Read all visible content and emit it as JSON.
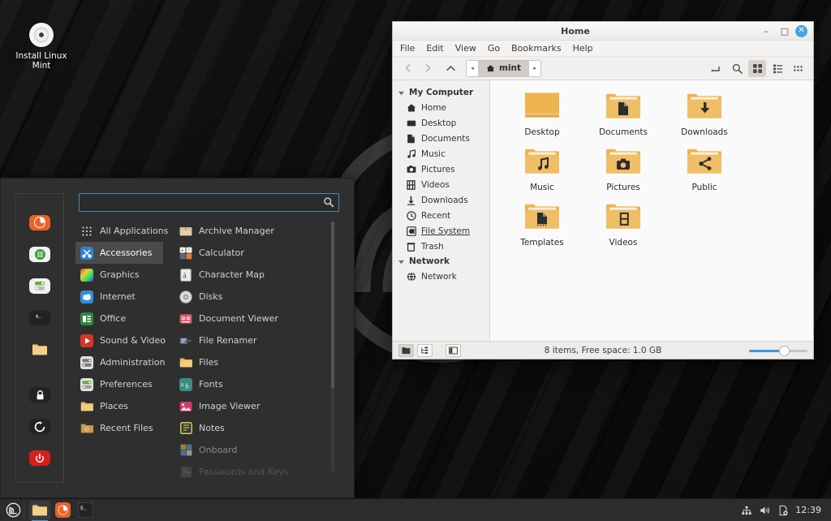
{
  "desktop": {
    "icon": {
      "label": "Install Linux Mint",
      "name": "install-linux-mint-icon"
    }
  },
  "menu": {
    "search": {
      "value": "",
      "placeholder": "",
      "icon": "search-icon"
    },
    "sidebar_icons": [
      {
        "name": "firefox-icon",
        "glyph": "◔",
        "bg": "#ea6227",
        "fg": "#ffffff"
      },
      {
        "name": "software-manager-icon",
        "glyph": "☷",
        "bg": "#f2f2f2",
        "fg": "#3aa143"
      },
      {
        "name": "update-manager-icon",
        "glyph": "☲",
        "bg": "#f2f2f2",
        "fg": "#6aab3d"
      },
      {
        "name": "terminal-icon",
        "glyph": "❯_",
        "bg": "#232323",
        "fg": "#e8e8e8"
      },
      {
        "name": "files-icon",
        "glyph": "▮",
        "bg": "#f0c070",
        "fg": "#f0c070"
      },
      {
        "name": "lock-screen-icon",
        "glyph": "ὑ2",
        "bg": "#232323",
        "fg": "#ffffff"
      },
      {
        "name": "logout-icon",
        "glyph": "↺",
        "bg": "#232323",
        "fg": "#ffffff"
      },
      {
        "name": "quit-icon",
        "glyph": "⏻",
        "bg": "#d81f1f",
        "fg": "#ffffff"
      }
    ],
    "categories": [
      {
        "label": "All Applications",
        "icon": "grid-icon",
        "selected": false,
        "color": "#cfcfcf"
      },
      {
        "label": "Accessories",
        "icon": "accessories-icon",
        "selected": true,
        "color": "#2f7fd0"
      },
      {
        "label": "Graphics",
        "icon": "graphics-icon",
        "selected": false,
        "color": "#8e44ad"
      },
      {
        "label": "Internet",
        "icon": "internet-icon",
        "selected": false,
        "color": "#2f8fd8"
      },
      {
        "label": "Office",
        "icon": "office-icon",
        "selected": false,
        "color": "#2e8b3d"
      },
      {
        "label": "Sound & Video",
        "icon": "sound-video-icon",
        "selected": false,
        "color": "#d8342c"
      },
      {
        "label": "Administration",
        "icon": "administration-icon",
        "selected": false,
        "color": "#d6d6d6"
      },
      {
        "label": "Preferences",
        "icon": "preferences-icon",
        "selected": false,
        "color": "#d6d6d6"
      },
      {
        "label": "Places",
        "icon": "places-folder-icon",
        "selected": false,
        "color": "#f0bc5e"
      },
      {
        "label": "Recent Files",
        "icon": "recent-files-icon",
        "selected": false,
        "color": "#c79a4e"
      }
    ],
    "applications": [
      {
        "label": "Archive Manager",
        "icon": "archive-manager-icon",
        "color": "#e8d2b0",
        "dim": 0
      },
      {
        "label": "Calculator",
        "icon": "calculator-icon",
        "color": "#e07a3a",
        "dim": 0
      },
      {
        "label": "Character Map",
        "icon": "character-map-icon",
        "color": "#e3e3e3",
        "dim": 0
      },
      {
        "label": "Disks",
        "icon": "disks-icon",
        "color": "#d6d6d6",
        "dim": 0
      },
      {
        "label": "Document Viewer",
        "icon": "document-viewer-icon",
        "color": "#e05a6a",
        "dim": 0
      },
      {
        "label": "File Renamer",
        "icon": "file-renamer-icon",
        "color": "#5b6c80",
        "dim": 0
      },
      {
        "label": "Files",
        "icon": "files-folder-icon",
        "color": "#f0bc5e",
        "dim": 0
      },
      {
        "label": "Fonts",
        "icon": "fonts-icon",
        "color": "#3d8b86",
        "dim": 0
      },
      {
        "label": "Image Viewer",
        "icon": "image-viewer-icon",
        "color": "#d33a6a",
        "dim": 0
      },
      {
        "label": "Notes",
        "icon": "notes-icon",
        "color": "#e8e05a",
        "dim": 0
      },
      {
        "label": "Onboard",
        "icon": "onboard-icon",
        "color": "#e8b23a",
        "dim": 1
      },
      {
        "label": "Passwords and Keys",
        "icon": "passwords-and-keys-icon",
        "color": "#8a8a8a",
        "dim": 2
      }
    ]
  },
  "file_manager": {
    "title": "Home",
    "window_buttons": {
      "minimize": "–",
      "maximize": "□",
      "close": "✕"
    },
    "menubar": [
      "File",
      "Edit",
      "View",
      "Go",
      "Bookmarks",
      "Help"
    ],
    "toolbar": {
      "back": "back-icon",
      "forward": "forward-icon",
      "up": "up-icon",
      "path_prev": "◂",
      "path_next": "▸",
      "crumb": "mint",
      "toggle_path_entry": "path-entry-icon",
      "search": "search-icon",
      "view_icons": "icon-view-icon",
      "view_list": "list-view-icon",
      "view_compact": "compact-view-icon"
    },
    "sidebar": [
      {
        "type": "group",
        "label": "My Computer",
        "icon": "chevron-down-icon"
      },
      {
        "type": "item",
        "label": "Home",
        "icon": "home-icon",
        "hover": false
      },
      {
        "type": "item",
        "label": "Desktop",
        "icon": "desktop-icon",
        "hover": false
      },
      {
        "type": "item",
        "label": "Documents",
        "icon": "document-icon",
        "hover": false
      },
      {
        "type": "item",
        "label": "Music",
        "icon": "music-note-icon",
        "hover": false
      },
      {
        "type": "item",
        "label": "Pictures",
        "icon": "camera-icon",
        "hover": false
      },
      {
        "type": "item",
        "label": "Videos",
        "icon": "film-icon",
        "hover": false
      },
      {
        "type": "item",
        "label": "Downloads",
        "icon": "download-arrow-icon",
        "hover": false
      },
      {
        "type": "item",
        "label": "Recent",
        "icon": "clock-icon",
        "hover": false
      },
      {
        "type": "item",
        "label": "File System",
        "icon": "harddisk-icon",
        "hover": true
      },
      {
        "type": "item",
        "label": "Trash",
        "icon": "trash-icon",
        "hover": false
      },
      {
        "type": "group",
        "label": "Network",
        "icon": "chevron-down-icon"
      },
      {
        "type": "item",
        "label": "Network",
        "icon": "globe-icon",
        "hover": false
      }
    ],
    "files": [
      {
        "label": "Desktop",
        "icon": "folder-plain-icon",
        "emblem": ""
      },
      {
        "label": "Documents",
        "icon": "folder-documents-icon",
        "emblem": "document"
      },
      {
        "label": "Downloads",
        "icon": "folder-downloads-icon",
        "emblem": "download"
      },
      {
        "label": "Music",
        "icon": "folder-music-icon",
        "emblem": "music"
      },
      {
        "label": "Pictures",
        "icon": "folder-pictures-icon",
        "emblem": "camera"
      },
      {
        "label": "Public",
        "icon": "folder-public-icon",
        "emblem": "share"
      },
      {
        "label": "Templates",
        "icon": "folder-templates-icon",
        "emblem": "template"
      },
      {
        "label": "Videos",
        "icon": "folder-videos-icon",
        "emblem": "film"
      }
    ],
    "status": {
      "text": "8 items, Free space: 1.0 GB",
      "buttons": [
        "places-toggle-icon",
        "treeview-toggle-icon",
        "split-pane-icon"
      ],
      "zoom_percent": 60
    }
  },
  "taskbar": {
    "menu_button": "mint-menu-icon",
    "launchers": [
      {
        "name": "files-launcher",
        "icon": "folder-icon",
        "active": true
      },
      {
        "name": "firefox-launcher",
        "icon": "firefox-icon",
        "active": false
      },
      {
        "name": "terminal-launcher",
        "icon": "terminal-icon",
        "active": false
      }
    ],
    "tray": [
      {
        "name": "network-icon",
        "glyph": "network"
      },
      {
        "name": "volume-icon",
        "glyph": "volume"
      },
      {
        "name": "update-notifier-icon",
        "glyph": "update"
      }
    ],
    "clock": "12:39"
  },
  "colors": {
    "accent": "#3c9ad9",
    "menu_bg": "#2f2f2f",
    "window_bg": "#f5f5f4",
    "folder": "#f0bc5e",
    "taskbar_bg": "#2c2c2c"
  }
}
